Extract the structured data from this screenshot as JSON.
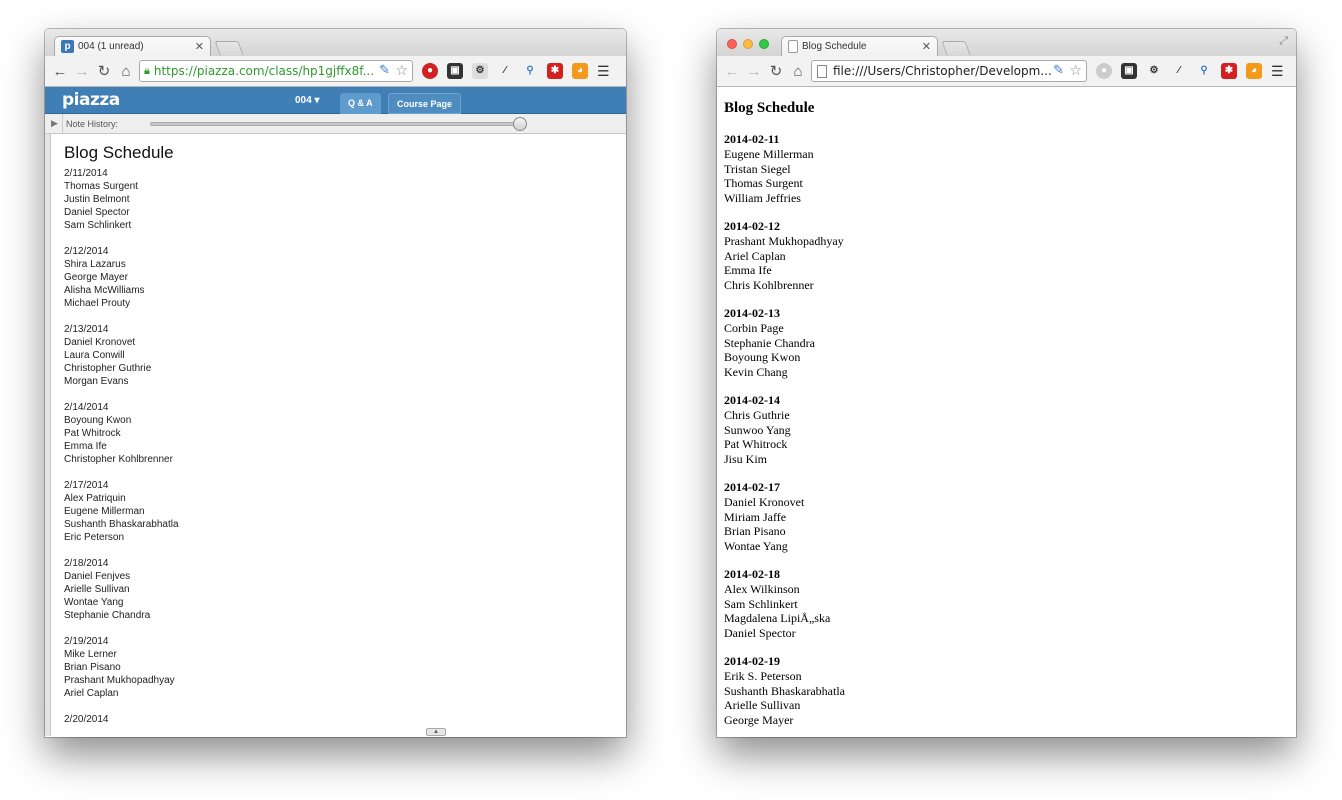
{
  "left_window": {
    "tab_title": "004 (1 unread)",
    "favicon": "p",
    "url": "https://piazza.com/class/hp1gjffx8f...",
    "piazza": {
      "logo": "piazza",
      "class_selector": "004",
      "tabs": [
        "Q & A",
        "Course Page"
      ],
      "note_history_label": "Note History:"
    },
    "note": {
      "title": "Blog Schedule",
      "groups": [
        {
          "date": "2/11/2014",
          "names": [
            "Thomas Surgent",
            "Justin Belmont",
            "Daniel Spector",
            "Sam Schlinkert"
          ]
        },
        {
          "date": "2/12/2014",
          "names": [
            "Shira Lazarus",
            "George Mayer",
            "Alisha McWilliams",
            "Michael Prouty"
          ]
        },
        {
          "date": "2/13/2014",
          "names": [
            "Daniel Kronovet",
            "Laura Conwill",
            "Christopher Guthrie",
            "Morgan Evans"
          ]
        },
        {
          "date": "2/14/2014",
          "names": [
            "Boyoung Kwon",
            "Pat Whitrock",
            "Emma Ife",
            "Christopher Kohlbrenner"
          ]
        },
        {
          "date": "2/17/2014",
          "names": [
            "Alex Patriquin",
            "Eugene Millerman",
            "Sushanth Bhaskarabhatla",
            "Eric Peterson"
          ]
        },
        {
          "date": "2/18/2014",
          "names": [
            "Daniel Fenjves",
            "Arielle Sullivan",
            "Wontae Yang",
            "Stephanie Chandra"
          ]
        },
        {
          "date": "2/19/2014",
          "names": [
            "Mike Lerner",
            "Brian Pisano",
            "Prashant Mukhopadhyay",
            "Ariel Caplan"
          ]
        },
        {
          "date": "2/20/2014",
          "names": []
        }
      ]
    }
  },
  "right_window": {
    "tab_title": "Blog Schedule",
    "url": "file:///Users/Christopher/Developm...",
    "page": {
      "title": "Blog Schedule",
      "groups": [
        {
          "date": "2014-02-11",
          "names": [
            "Eugene Millerman",
            "Tristan Siegel",
            "Thomas Surgent",
            "William Jeffries"
          ]
        },
        {
          "date": "2014-02-12",
          "names": [
            "Prashant Mukhopadhyay",
            "Ariel Caplan",
            "Emma Ife",
            "Chris Kohlbrenner"
          ]
        },
        {
          "date": "2014-02-13",
          "names": [
            "Corbin Page",
            "Stephanie Chandra",
            "Boyoung Kwon",
            "Kevin Chang"
          ]
        },
        {
          "date": "2014-02-14",
          "names": [
            "Chris Guthrie",
            "Sunwoo Yang",
            "Pat Whitrock",
            "Jisu Kim"
          ]
        },
        {
          "date": "2014-02-17",
          "names": [
            "Daniel Kronovet",
            "Miriam Jaffe",
            "Brian Pisano",
            "Wontae Yang"
          ]
        },
        {
          "date": "2014-02-18",
          "names": [
            "Alex Wilkinson",
            "Sam Schlinkert",
            "Magdalena LipiÅ„ska",
            "Daniel Spector"
          ]
        },
        {
          "date": "2014-02-19",
          "names": [
            "Erik S. Peterson",
            "Sushanth Bhaskarabhatla",
            "Arielle Sullivan",
            "George Mayer"
          ]
        }
      ]
    }
  },
  "colors": {
    "piazza_header": "#3f7fb5",
    "piazza_favicon": "#3a78b8",
    "secure_url_green": "#2e9a2e"
  },
  "icons": [
    "back-icon",
    "forward-icon",
    "reload-icon",
    "home-icon",
    "lock-icon",
    "star-icon",
    "gear-icon",
    "menu-icon",
    "close-icon",
    "play-icon",
    "page-icon",
    "fullscreen-icon"
  ]
}
